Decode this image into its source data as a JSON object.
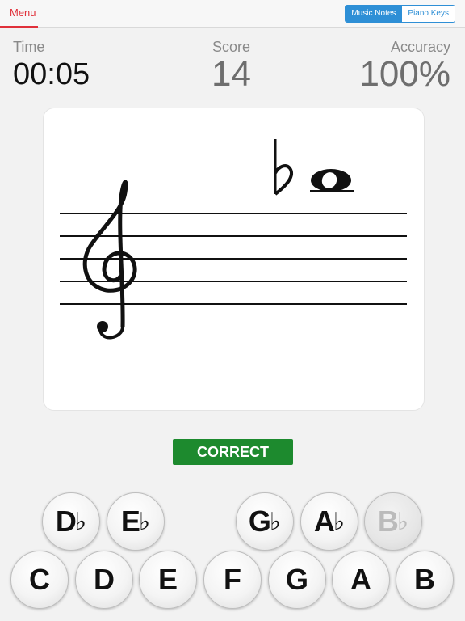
{
  "topbar": {
    "menu_label": "Menu",
    "modes": [
      "Music Notes",
      "Piano Keys"
    ]
  },
  "stats": {
    "time_label": "Time",
    "time_value": "00:05",
    "score_label": "Score",
    "score_value": "14",
    "accuracy_label": "Accuracy",
    "accuracy_value": "100%"
  },
  "staff": {
    "clef": "treble-clef",
    "note_accidental": "♭",
    "note": "whole-note"
  },
  "feedback": {
    "text": "CORRECT",
    "color": "#1d8a2e"
  },
  "keys": {
    "flats": [
      {
        "letter": "D",
        "accidental": "♭"
      },
      {
        "letter": "E",
        "accidental": "♭"
      },
      {
        "letter": "G",
        "accidental": "♭"
      },
      {
        "letter": "A",
        "accidental": "♭"
      },
      {
        "letter": "B",
        "accidental": "♭"
      }
    ],
    "naturals": [
      "C",
      "D",
      "E",
      "F",
      "G",
      "A",
      "B"
    ]
  },
  "colors": {
    "accent": "#2e8fd6",
    "menu": "#e0303a",
    "correct": "#1d8a2e"
  }
}
